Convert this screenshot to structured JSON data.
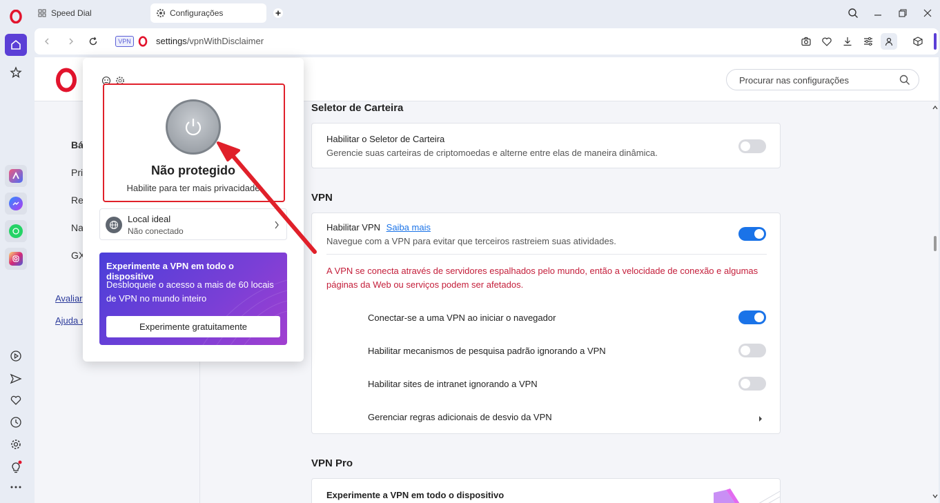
{
  "tabs": [
    {
      "label": "Speed Dial",
      "icon": "grid-icon"
    },
    {
      "label": "Configurações",
      "icon": "gear-icon"
    }
  ],
  "address": {
    "host": "settings",
    "path": "/vpnWithDisclaimer",
    "vpn_badge": "VPN"
  },
  "search": {
    "placeholder": "Procurar nas configurações"
  },
  "left_nav": {
    "items": [
      "Bá",
      "Pri",
      "Re",
      "Na",
      "GX"
    ],
    "links": [
      "Avaliar",
      "Ajuda c"
    ]
  },
  "popup": {
    "status_title": "Não protegido",
    "status_sub": "Habilite para ter mais privacidade",
    "location_title": "Local ideal",
    "location_sub": "Não conectado",
    "promo_title": "Experimente a VPN em todo o dispositivo",
    "promo_text": "Desbloqueie o acesso a mais de 60 locais de VPN no mundo inteiro",
    "promo_button": "Experimente gratuitamente"
  },
  "sections": {
    "wallet": {
      "title": "Seletor de Carteira",
      "row_title": "Habilitar o Seletor de Carteira",
      "row_sub": "Gerencie suas carteiras de criptomoedas e alterne entre elas de maneira dinâmica.",
      "enabled": false
    },
    "vpn": {
      "title": "VPN",
      "enable_title": "Habilitar VPN",
      "learn_more": "Saiba mais",
      "enable_sub": "Navegue com a VPN para evitar que terceiros rastreiem suas atividades.",
      "enabled": true,
      "warning": "A VPN se conecta através de servidores espalhados pelo mundo, então a velocidade de conexão e algumas páginas da Web ou serviços podem ser afetados.",
      "opt_connect_start": "Conectar-se a uma VPN ao iniciar o navegador",
      "opt_connect_start_on": true,
      "opt_search_bypass": "Habilitar mecanismos de pesquisa padrão ignorando a VPN",
      "opt_search_bypass_on": false,
      "opt_intranet_bypass": "Habilitar sites de intranet ignorando a VPN",
      "opt_intranet_bypass_on": false,
      "manage_rules": "Gerenciar regras adicionais de desvio da VPN"
    },
    "vpn_pro": {
      "title": "VPN Pro",
      "row_title": "Experimente a VPN em todo o dispositivo"
    }
  },
  "colors": {
    "accent": "#1a73e8",
    "opera_red": "#e2142d",
    "warning": "#c41e3a",
    "highlight": "#e0202a"
  }
}
